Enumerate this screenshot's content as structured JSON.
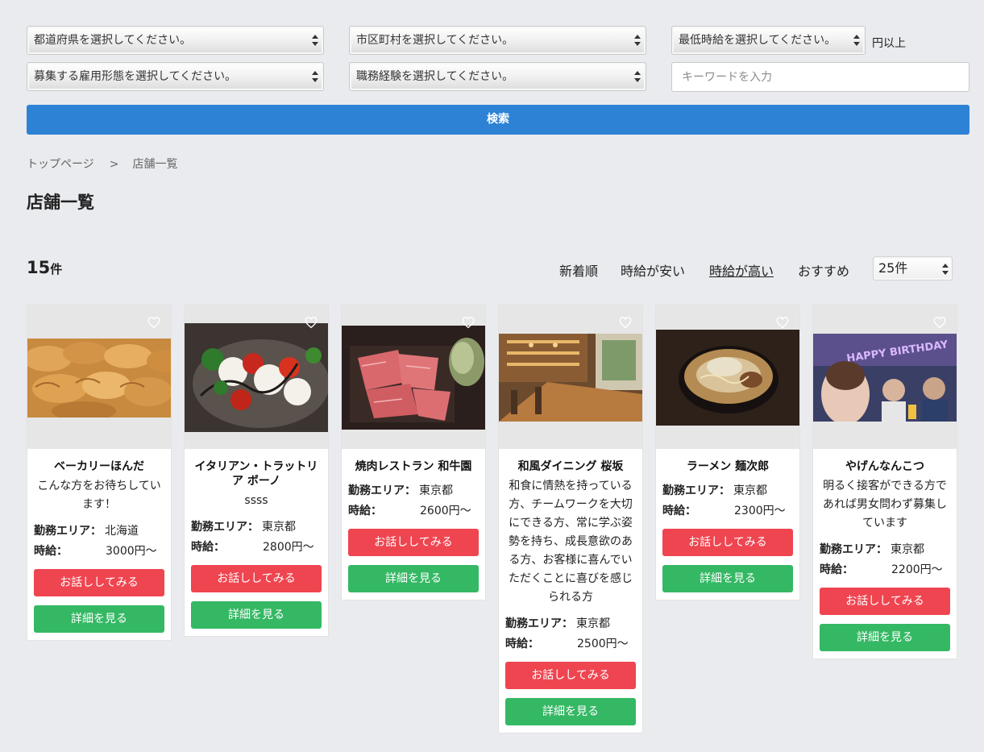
{
  "filters": {
    "prefecture": "都道府県を選択してください。",
    "city": "市区町村を選択してください。",
    "min_wage": "最低時給を選択してください。",
    "min_wage_suffix": "円以上",
    "employment_type": "募集する雇用形態を選択してください。",
    "experience": "職務経験を選択してください。",
    "keyword_placeholder": "キーワードを入力",
    "search_label": "検索"
  },
  "breadcrumb": {
    "top": "トップページ",
    "separator": ">",
    "current": "店舗一覧"
  },
  "page_title": "店舗一覧",
  "results": {
    "count": "15",
    "count_unit": "件",
    "sort_options": [
      "新着順",
      "時給が安い",
      "時給が高い",
      "おすすめ"
    ],
    "active_sort": "時給が高い",
    "per_page": "25件"
  },
  "labels": {
    "area": "勤務エリア：",
    "wage": "時給：",
    "talk": "お話ししてみる",
    "detail": "詳細を見る"
  },
  "shops": [
    {
      "name": "ベーカリーほんだ",
      "desc": "こんな方をお待ちしています！",
      "area": "北海道",
      "wage": "3000円〜"
    },
    {
      "name": "イタリアン・トラットリア ボーノ",
      "desc": "ssss",
      "area": "東京都",
      "wage": "2800円〜"
    },
    {
      "name": "焼肉レストラン 和牛園",
      "desc": "",
      "area": "東京都",
      "wage": "2600円〜"
    },
    {
      "name": "和風ダイニング 桜坂",
      "desc": "和食に情熱を持っている方、チームワークを大切にできる方、常に学ぶ姿勢を持ち、成長意欲のある方、お客様に喜んでいただくことに喜びを感じられる方",
      "area": "東京都",
      "wage": "2500円〜"
    },
    {
      "name": "ラーメン 麺次郎",
      "desc": "",
      "area": "東京都",
      "wage": "2300円〜"
    },
    {
      "name": "やげんなんこつ",
      "desc": "明るく接客ができる方であれば男女問わず募集しています",
      "area": "東京都",
      "wage": "2200円〜"
    }
  ],
  "photo_banner": "HAPPY BIRTHDAY",
  "colors": {
    "search": "#2e82d6",
    "talk": "#ef4550",
    "detail": "#35b864",
    "background": "#eaebee"
  },
  "icons": {
    "favorite": "heart-outline-icon",
    "select": "updown-chevron-icon"
  }
}
